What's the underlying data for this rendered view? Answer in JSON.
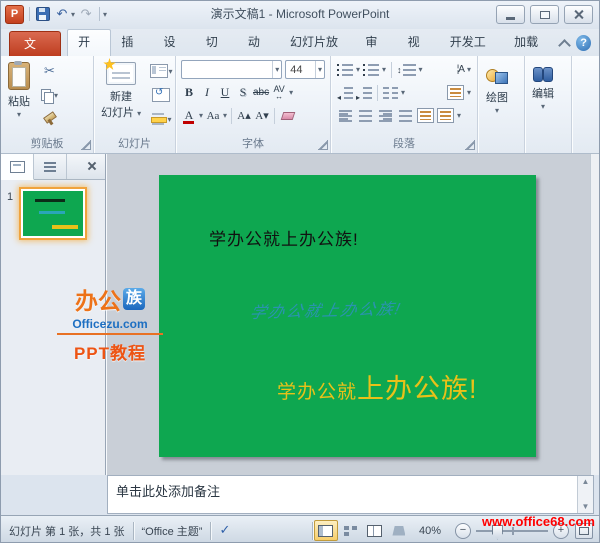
{
  "titlebar": {
    "title": "演示文稿1 - Microsoft PowerPoint"
  },
  "glyphs": {
    "undo": "↶",
    "redo": "↷",
    "cut": "✂",
    "help": "?",
    "spacing_updown": "↕",
    "text_direction": "¦A",
    "check": "✓",
    "bold": "B",
    "italic": "I",
    "underline": "U",
    "shadow": "S",
    "strikethrough": "abc",
    "char_spacing_av": "AV",
    "char_spacing_arrow": "↔",
    "font_color": "A",
    "change_case": "Aa",
    "grow_font": "A▴",
    "shrink_font": "A▾",
    "scroll_up": "▲",
    "scroll_down": "▼"
  },
  "ribbon": {
    "file_tab": "文件",
    "tabs": [
      "开始",
      "插入",
      "设计",
      "切换",
      "动画",
      "幻灯片放映",
      "审阅",
      "视图",
      "开发工具",
      "加载项"
    ],
    "active_tab": "开始",
    "clipboard": {
      "label": "剪贴板",
      "paste": "粘贴"
    },
    "slides": {
      "label": "幻灯片",
      "new_slide_line1": "新建",
      "new_slide_line2": "幻灯片"
    },
    "font": {
      "label": "字体",
      "font_size": "44"
    },
    "paragraph": {
      "label": "段落"
    },
    "drawing": {
      "label": "绘图"
    },
    "editing": {
      "label": "编辑"
    }
  },
  "panel": {
    "slide_number": "1"
  },
  "slide": {
    "background": "#0EA750",
    "line1": {
      "text": "学办公就上办公族!",
      "color": "#111111"
    },
    "line2": {
      "text": "学办公就上办公族!",
      "color": "#2B93B0"
    },
    "line3": {
      "text_small": "学办公就",
      "text_large": "上办公族!",
      "color": "#E9C119"
    }
  },
  "watermark": {
    "name_left": "办公",
    "name_right": "族",
    "domain": "Officezu.com",
    "caption": "PPT教程"
  },
  "notes": {
    "placeholder": "单击此处添加备注"
  },
  "statusbar": {
    "slide_info": "幻灯片 第 1 张，共 1 张",
    "theme": "“Office 主题”",
    "zoom_level": "40%"
  },
  "overlay_url": "www.office68.com"
}
